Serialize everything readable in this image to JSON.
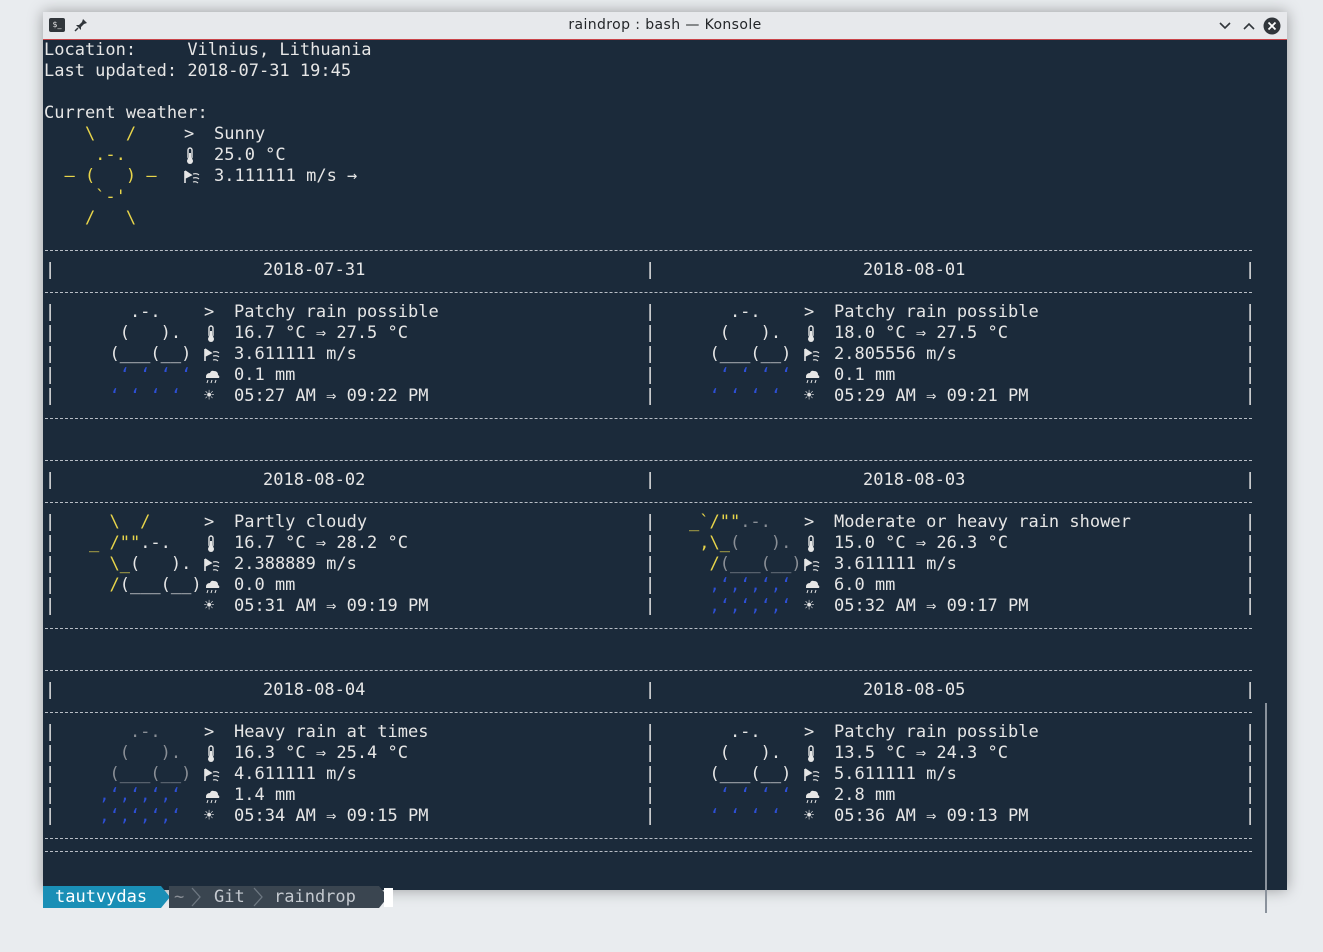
{
  "window": {
    "title": "raindrop : bash — Konsole"
  },
  "current": {
    "location_label": "Location:",
    "location_value": "Vilnius, Lithuania",
    "updated_label": "Last updated:",
    "updated_value": "2018-07-31 19:45",
    "heading": "Current weather:",
    "condition": "Sunny",
    "temperature": "25.0 °C",
    "wind": "3.111111 m/s →"
  },
  "forecast": [
    {
      "date": "2018-07-31",
      "condition": "Patchy rain possible",
      "temp": "16.7 °C ⇒ 27.5 °C",
      "wind": "3.611111 m/s",
      "precip": "0.1 mm",
      "sun": "05:27 AM ⇒ 09:22 PM"
    },
    {
      "date": "2018-08-01",
      "condition": "Patchy rain possible",
      "temp": "18.0 °C ⇒ 27.5 °C",
      "wind": "2.805556 m/s",
      "precip": "0.1 mm",
      "sun": "05:29 AM ⇒ 09:21 PM"
    },
    {
      "date": "2018-08-02",
      "condition": "Partly cloudy",
      "temp": "16.7 °C ⇒ 28.2 °C",
      "wind": "2.388889 m/s",
      "precip": "0.0 mm",
      "sun": "05:31 AM ⇒ 09:19 PM"
    },
    {
      "date": "2018-08-03",
      "condition": "Moderate or heavy rain shower",
      "temp": "15.0 °C ⇒ 26.3 °C",
      "wind": "3.611111 m/s",
      "precip": "6.0 mm",
      "sun": "05:32 AM ⇒ 09:17 PM"
    },
    {
      "date": "2018-08-04",
      "condition": "Heavy rain at times",
      "temp": "16.3 °C ⇒ 25.4 °C",
      "wind": "4.611111 m/s",
      "precip": "1.4 mm",
      "sun": "05:34 AM ⇒ 09:15 PM"
    },
    {
      "date": "2018-08-05",
      "condition": "Patchy rain possible",
      "temp": "13.5 °C ⇒ 24.3 °C",
      "wind": "5.611111 m/s",
      "precip": "2.8 mm",
      "sun": "05:36 AM ⇒ 09:13 PM"
    }
  ],
  "markers": {
    "condition": ">",
    "sun": "☀"
  },
  "prompt": {
    "user": "tautvydas",
    "home": "~",
    "dir1": "Git",
    "dir2": "raindrop"
  },
  "colors": {
    "background": "#1b2a3a",
    "accent": "#1a8fb6",
    "sun": "#e8d54a",
    "rain": "#2d4fd6"
  }
}
